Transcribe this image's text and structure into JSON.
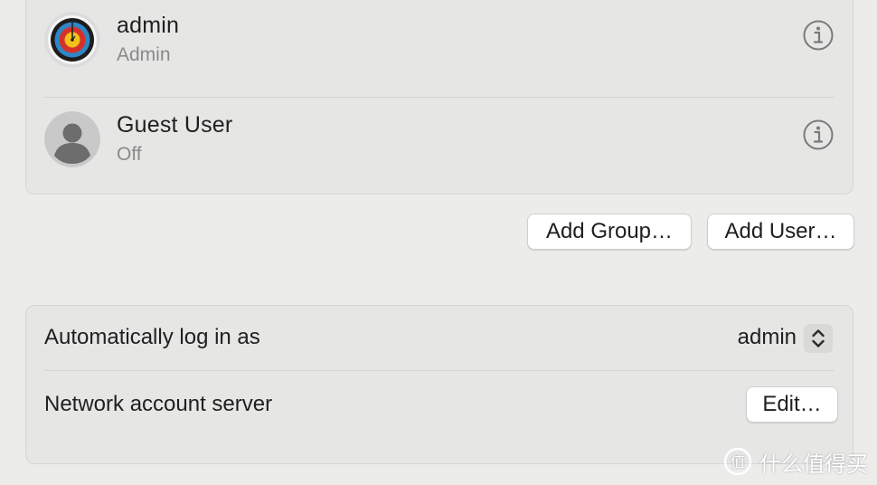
{
  "users": [
    {
      "name": "admin",
      "subtitle": "Admin",
      "avatar": "archery-target-icon",
      "info_icon": "info-icon"
    },
    {
      "name": "Guest User",
      "subtitle": "Off",
      "avatar": "person-silhouette-icon",
      "info_icon": "info-icon"
    }
  ],
  "actions": {
    "add_group_label": "Add Group…",
    "add_user_label": "Add User…"
  },
  "login": {
    "auto_login_label": "Automatically log in as",
    "auto_login_value": "admin",
    "stepper_icon": "up-down-chevron-icon",
    "network_server_label": "Network account server",
    "edit_label": "Edit…"
  },
  "watermark": {
    "text": "什么值得买",
    "logo_icon": "value-logo-icon"
  },
  "colors": {
    "background": "#ececeb",
    "panel": "#e6e6e5",
    "secondary_text": "#8a8a8a"
  }
}
